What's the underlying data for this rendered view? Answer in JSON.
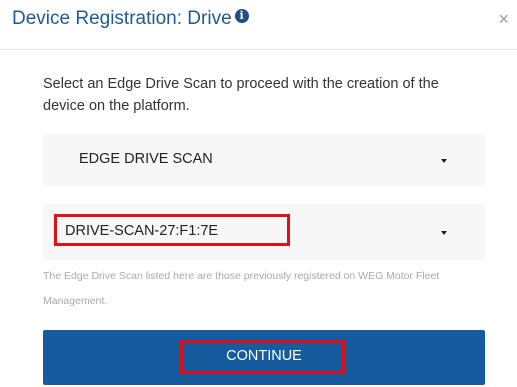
{
  "header": {
    "title": "Device Registration: Drive",
    "info_icon": "info-icon",
    "info_glyph": "i",
    "close_icon": "close-icon",
    "close_glyph": "×"
  },
  "body": {
    "description": "Select an Edge Drive Scan to proceed with the creation of the device on the platform.",
    "select_type": {
      "selected_value": "EDGE DRIVE SCAN",
      "icon": "caret-down-icon"
    },
    "select_device": {
      "selected_value": "DRIVE-SCAN-27:F1:7E",
      "icon": "caret-down-icon"
    },
    "help_text": "The Edge Drive Scan listed here are those previously registered on WEG Motor Fleet Management."
  },
  "footer": {
    "continue_label": "CONTINUE"
  },
  "colors": {
    "title": "#1f5a96",
    "button_bg": "#145c9e",
    "highlight_border": "#e0101a"
  }
}
